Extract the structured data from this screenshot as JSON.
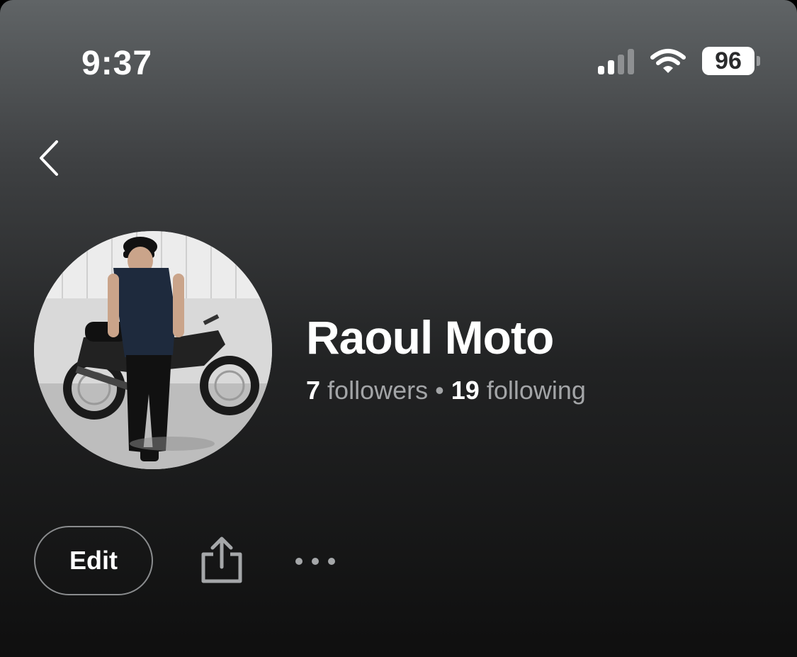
{
  "status_bar": {
    "time": "9:37",
    "battery": "96"
  },
  "profile": {
    "name": "Raoul Moto"
  },
  "stats": {
    "followers_count": "7",
    "followers_label": "followers",
    "separator": "•",
    "following_count": "19",
    "following_label": "following"
  },
  "actions": {
    "edit_label": "Edit"
  },
  "icons": {
    "back": "chevron-left-icon",
    "share": "share-icon",
    "more": "ellipsis-icon",
    "signal": "cellular-signal-icon",
    "wifi": "wifi-icon",
    "battery": "battery-icon"
  },
  "colors": {
    "background_top": "#606466",
    "background_bottom": "#0f0f0f",
    "secondary_text": "#a3a5a7"
  }
}
